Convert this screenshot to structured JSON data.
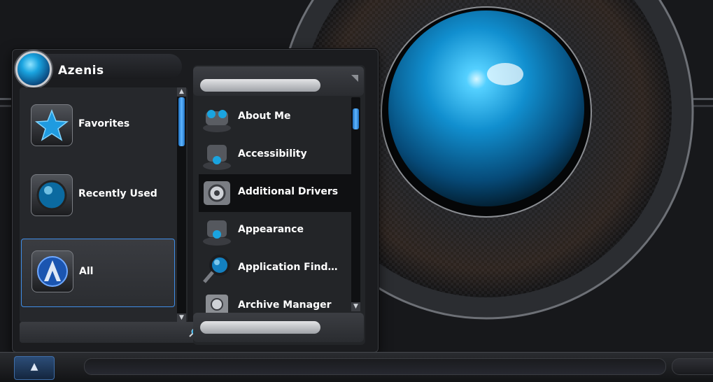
{
  "menu": {
    "title": "Azenis"
  },
  "categories": [
    {
      "label": "Favorites",
      "icon": "star-icon",
      "selected": false
    },
    {
      "label": "Recently Used",
      "icon": "orb-icon",
      "selected": false
    },
    {
      "label": "All",
      "icon": "azenis-logo-icon",
      "selected": true
    }
  ],
  "apps": [
    {
      "label": "About Me",
      "icon": "about-me-icon"
    },
    {
      "label": "Accessibility",
      "icon": "accessibility-icon"
    },
    {
      "label": "Additional Drivers",
      "icon": "drivers-icon"
    },
    {
      "label": "Appearance",
      "icon": "appearance-icon"
    },
    {
      "label": "Application Find…",
      "icon": "magnifier-icon"
    },
    {
      "label": "Archive Manager",
      "icon": "archive-icon"
    }
  ],
  "colors": {
    "accent": "#3f8ee8",
    "orb": "#1aa4e0"
  }
}
